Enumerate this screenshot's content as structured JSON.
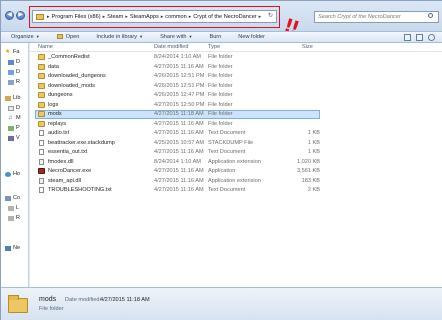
{
  "address": {
    "crumbs": [
      "Program Files (x86)",
      "Steam",
      "SteamApps",
      "common",
      "Crypt of the NecroDancer"
    ],
    "search_placeholder": "Search Crypt of the NecroDancer"
  },
  "annotation": {
    "exclamation": "!!"
  },
  "toolbar": {
    "organize": "Organize",
    "open": "Open",
    "include_in_library": "Include in library",
    "share_with": "Share with",
    "burn": "Burn",
    "new_folder": "New folder"
  },
  "nav_pane": {
    "items": [
      {
        "label": "Fa",
        "icon": "star-icon"
      },
      {
        "label": "D",
        "icon": "desktop-icon"
      },
      {
        "label": "D",
        "icon": "downloads-icon"
      },
      {
        "label": "R",
        "icon": "recent-places-icon"
      },
      {
        "label": "Lib",
        "icon": "library-icon"
      },
      {
        "label": "D",
        "icon": "documents-icon"
      },
      {
        "label": "M",
        "icon": "music-icon"
      },
      {
        "label": "P",
        "icon": "pictures-icon"
      },
      {
        "label": "V",
        "icon": "videos-icon"
      },
      {
        "label": "Ho",
        "icon": "homegroup-icon"
      },
      {
        "label": "Co",
        "icon": "computer-icon"
      },
      {
        "label": "L",
        "icon": "drive-icon"
      },
      {
        "label": "R",
        "icon": "drive-icon"
      },
      {
        "label": "Ne",
        "icon": "network-icon"
      }
    ]
  },
  "columns": {
    "name": "Name",
    "date_modified": "Date modified",
    "type": "Type",
    "size": "Size"
  },
  "files": [
    {
      "name": "_CommonRedist",
      "date": "8/24/2014 1:10 AM",
      "type": "File folder",
      "size": "",
      "icon": "folder"
    },
    {
      "name": "data",
      "date": "4/27/2015 11:16 AM",
      "type": "File folder",
      "size": "",
      "icon": "folder"
    },
    {
      "name": "downloaded_dungeons",
      "date": "4/26/2015 12:51 PM",
      "type": "File folder",
      "size": "",
      "icon": "folder"
    },
    {
      "name": "downloaded_mods",
      "date": "4/26/2015 12:51 PM",
      "type": "File folder",
      "size": "",
      "icon": "folder"
    },
    {
      "name": "dungeons",
      "date": "4/26/2015 12:47 PM",
      "type": "File folder",
      "size": "",
      "icon": "folder"
    },
    {
      "name": "logs",
      "date": "4/27/2015 12:50 PM",
      "type": "File folder",
      "size": "",
      "icon": "folder"
    },
    {
      "name": "mods",
      "date": "4/27/2015 11:18 AM",
      "type": "File folder",
      "size": "",
      "icon": "folder"
    },
    {
      "name": "replays",
      "date": "4/27/2015 11:16 AM",
      "type": "File folder",
      "size": "",
      "icon": "folder"
    },
    {
      "name": "audio.txt",
      "date": "4/27/2015 11:16 AM",
      "type": "Text Document",
      "size": "1 KB",
      "icon": "doc"
    },
    {
      "name": "beattracker.exe.stackdump",
      "date": "4/25/2015 10:57 AM",
      "type": "STACKDUMP File",
      "size": "1 KB",
      "icon": "doc"
    },
    {
      "name": "essentia_out.txt",
      "date": "4/27/2015 11:16 AM",
      "type": "Text Document",
      "size": "1 KB",
      "icon": "doc"
    },
    {
      "name": "fmodex.dll",
      "date": "8/24/2014 1:10 AM",
      "type": "Application extension",
      "size": "1,020 KB",
      "icon": "dll"
    },
    {
      "name": "NecroDancer.exe",
      "date": "4/27/2015 11:16 AM",
      "type": "Application",
      "size": "3,561 KB",
      "icon": "game"
    },
    {
      "name": "steam_api.dll",
      "date": "4/27/2015 11:16 AM",
      "type": "Application extension",
      "size": "183 KB",
      "icon": "dll"
    },
    {
      "name": "TROUBLESHOOTING.txt",
      "date": "4/27/2015 11:16 AM",
      "type": "Text Document",
      "size": "2 KB",
      "icon": "doc"
    }
  ],
  "selected_index": 6,
  "details": {
    "name": "mods",
    "date_label": "Date modified:",
    "date": "4/27/2015 11:18 AM",
    "type": "File folder"
  }
}
